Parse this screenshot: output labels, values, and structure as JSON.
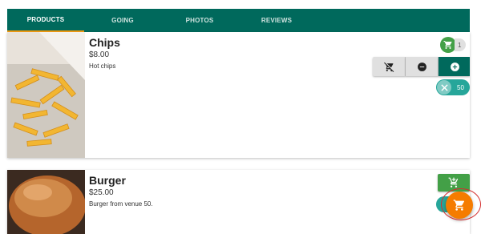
{
  "tabs": [
    {
      "label": "PRODUCTS"
    },
    {
      "label": "GOING"
    },
    {
      "label": "PHOTOS"
    },
    {
      "label": "REVIEWS"
    }
  ],
  "products": [
    {
      "name": "Chips",
      "price": "$8.00",
      "description": "Hot chips",
      "cart_count": "1",
      "quantity": "50"
    },
    {
      "name": "Burger",
      "price": "$25.00",
      "description": "Burger from venue 50."
    }
  ],
  "colors": {
    "accent": "#00695c",
    "tab_indicator": "#f39c12",
    "fab": "#f57c00",
    "cart_green": "#43a047"
  }
}
